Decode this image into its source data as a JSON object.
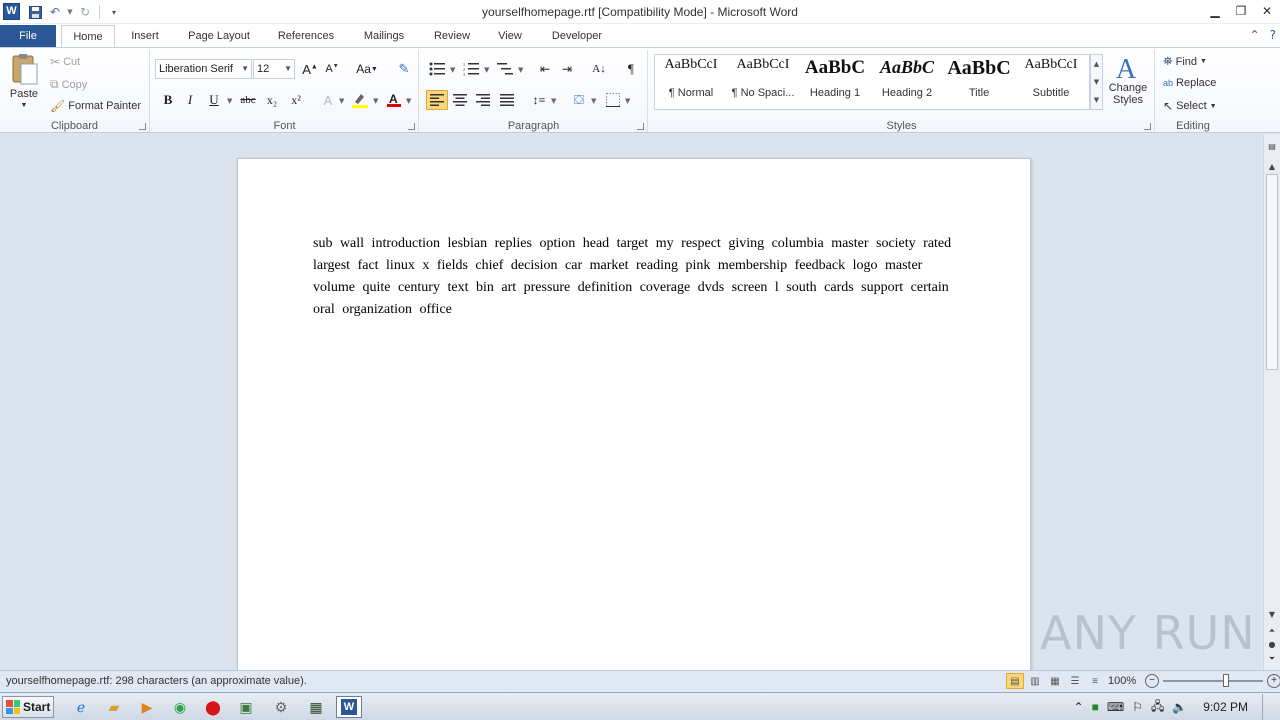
{
  "window": {
    "title": "yourselfhomepage.rtf [Compatibility Mode]  -  Microsoft Word",
    "app_icon": "W"
  },
  "tabs": [
    "File",
    "Home",
    "Insert",
    "Page Layout",
    "References",
    "Mailings",
    "Review",
    "View",
    "Developer"
  ],
  "active_tab": "Home",
  "clipboard": {
    "paste": "Paste",
    "cut": "Cut",
    "copy": "Copy",
    "format_painter": "Format Painter",
    "label": "Clipboard"
  },
  "font": {
    "family": "Liberation Serif",
    "size": "12",
    "label": "Font",
    "bold": "B",
    "italic": "I",
    "underline": "U",
    "strike": "abc",
    "subscript": "x₂",
    "superscript": "x²",
    "change_case": "Aa"
  },
  "paragraph": {
    "label": "Paragraph",
    "pilcrow": "¶"
  },
  "styles": {
    "label": "Styles",
    "items": [
      {
        "preview": "AaBbCcI",
        "name": "¶ Normal"
      },
      {
        "preview": "AaBbCcI",
        "name": "¶ No Spaci..."
      },
      {
        "preview": "AaBbC",
        "name": "Heading 1"
      },
      {
        "preview": "AaBbC",
        "name": "Heading 2"
      },
      {
        "preview": "AaBbC",
        "name": "Title"
      },
      {
        "preview": "AaBbCcI",
        "name": "Subtitle"
      }
    ],
    "change_styles": "Change Styles"
  },
  "editing": {
    "label": "Editing",
    "find": "Find",
    "replace": "Replace",
    "select": "Select"
  },
  "document": {
    "text": "sub wall  introduction     lesbian    replies  option  head target     my    respect    giving   columbia  master  society  rated largest     fact    linux  x     fields   chief         decision      car market reading     pink     membership     feedback  logo  master      volume   quite  century  text    bin  art pressure  definition   coverage  dvds    screen    l south  cards support    certain     oral  organization   office"
  },
  "status": {
    "text": "yourselfhomepage.rtf: 298 characters (an approximate value).",
    "zoom": "100%"
  },
  "taskbar": {
    "start": "Start",
    "clock": "9:02 PM"
  },
  "watermark": "ANY RUN"
}
